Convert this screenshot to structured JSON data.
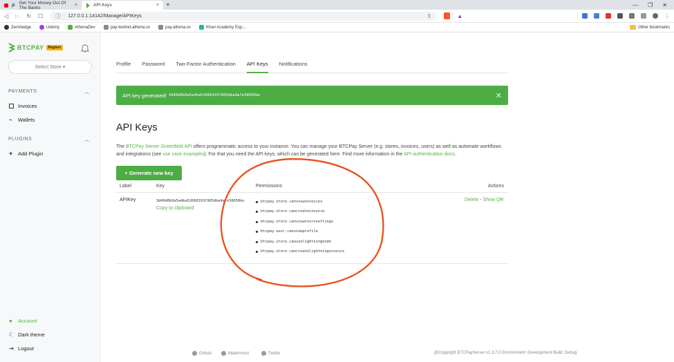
{
  "browser": {
    "tabs": [
      {
        "title": "Get Your Money Out Of The Banks"
      },
      {
        "title": "API Keys"
      }
    ],
    "new_tab": "+",
    "window_controls": [
      "—",
      "❐",
      "✕"
    ],
    "url": "127.0.0.1:14142/Manage/APIKeys",
    "bookmarks": [
      {
        "label": "Zerohedge"
      },
      {
        "label": "Udemy"
      },
      {
        "label": "AthenaDev"
      },
      {
        "label": "pay-testnet.athena.sv"
      },
      {
        "label": "pay.athena.sv"
      },
      {
        "label": "Khan Academy Esp..."
      }
    ],
    "other_bookmarks": "Other bookmarks"
  },
  "sidebar": {
    "logo": "BTCPAY",
    "badge": "Regtest",
    "store_select": "Select Store ▾",
    "payments_title": "PAYMENTS",
    "payments_items": [
      {
        "label": "Invoices"
      },
      {
        "label": "Wallets"
      }
    ],
    "plugins_title": "PLUGINS",
    "plugins_items": [
      {
        "label": "Add Plugin"
      }
    ],
    "bottom_items": [
      {
        "label": "Account"
      },
      {
        "label": "Dark theme"
      },
      {
        "label": "Logout"
      }
    ]
  },
  "main": {
    "tabs": [
      {
        "label": "Profile"
      },
      {
        "label": "Password"
      },
      {
        "label": "Two-Factor Authentication"
      },
      {
        "label": "API Keys"
      },
      {
        "label": "Notifications"
      }
    ],
    "alert": {
      "text": "API key generated!",
      "key": "3d40d0b9a5a4ba52660193f965dba4a7e58650be"
    },
    "title": "API Keys",
    "intro": {
      "p1": "The ",
      "link1": "BTCPay Server Greenfield API",
      "p2": " offers programmatic access to your instance. You can manage your BTCPay Server (e.g. stores, invoices, users) as well as automate workflows and integrations (see ",
      "link2": "use case examples",
      "p3": "). For that you need the API keys, which can be generated here. Find more information in the ",
      "link3": "API authentication docs",
      "p4": "."
    },
    "generate_button": "+ Generate new key",
    "table": {
      "headers": {
        "label": "Label",
        "key": "Key",
        "permissions": "Permissions",
        "actions": "Actions"
      },
      "row": {
        "label": "APIKey",
        "key": "3d40d0b9a5a4ba52660193f965dba4a7e58650be",
        "copy": "Copy to clipboard",
        "permissions": [
          "btcpay.store.canviewinvoices",
          "btcpay.store.cancreateinvoice",
          "btcpay.store.canviewstoresettings",
          "btcpay.user.canviewprofile",
          "btcpay.store.canuselightningnode",
          "btcpay.store.cancreatelightninginvoice"
        ],
        "delete": "Delete",
        "separator": "-",
        "show_qr": "Show QR"
      }
    }
  },
  "footer": {
    "links": [
      {
        "label": "Github"
      },
      {
        "label": "Mattermost"
      },
      {
        "label": "Twitter"
      }
    ],
    "copyright": "@Copyright BTCPayServer v1.3.7.0 Environment: Development Build: Debug"
  },
  "colors": {
    "brand_green": "#51b13e",
    "alert_green": "#4cad45",
    "annotation_orange": "#e8531e"
  }
}
